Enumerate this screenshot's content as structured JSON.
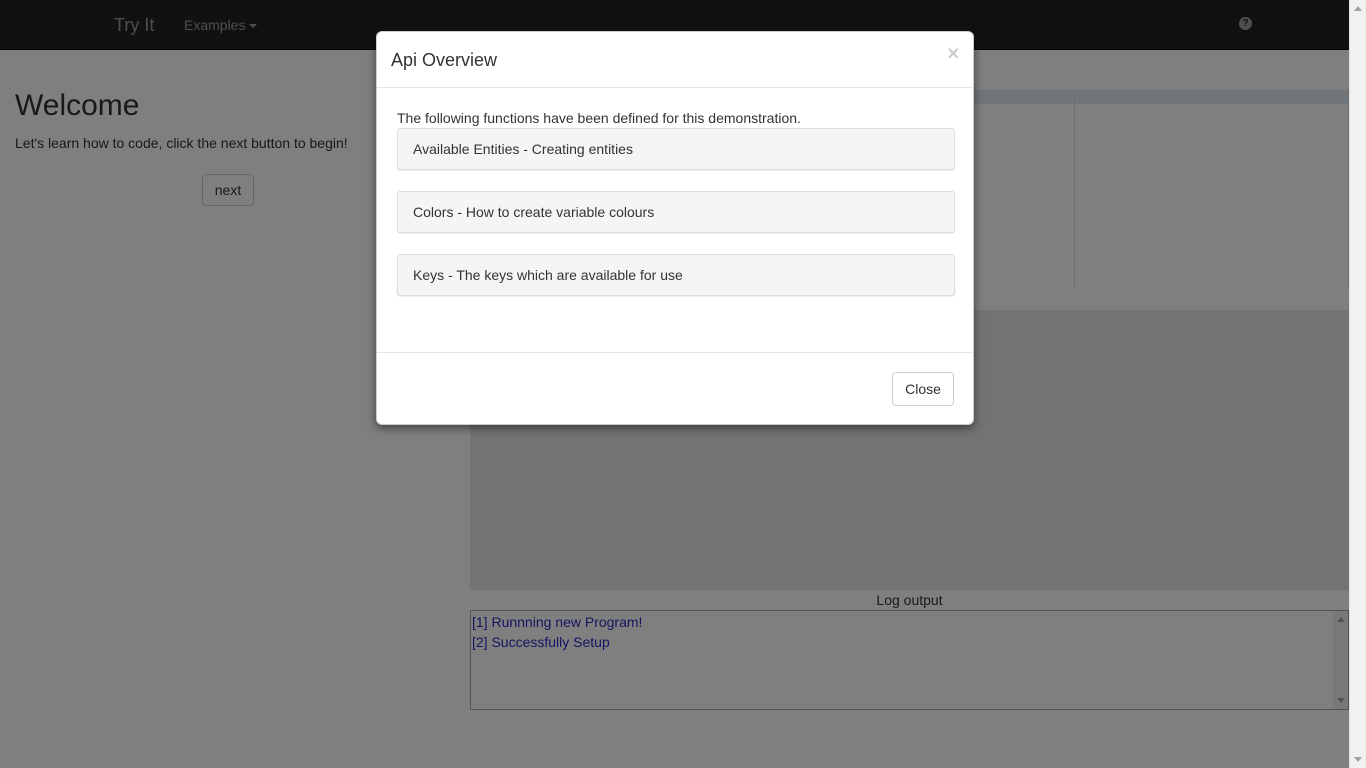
{
  "navbar": {
    "brand": "Try It",
    "examples_label": "Examples",
    "help_icon": "question-circle-icon"
  },
  "page": {
    "title": "Welcome",
    "intro": "Let's learn how to code, click the next button to begin!",
    "next_label": "next"
  },
  "log": {
    "title": "Log output",
    "lines": [
      "[1] Runnning new Program!",
      "[2] Successfully Setup"
    ]
  },
  "modal": {
    "title": "Api Overview",
    "close_x": "×",
    "intro": "The following functions have been defined for this demonstration.",
    "panels": [
      "Available Entities - Creating entities",
      "Colors - How to create variable colours",
      "Keys - The keys which are available for use"
    ],
    "close_label": "Close"
  },
  "colors": {
    "navbar_bg": "#222222",
    "log_text": "#2b2bc4",
    "backdrop": "rgba(0,0,0,0.5)"
  }
}
